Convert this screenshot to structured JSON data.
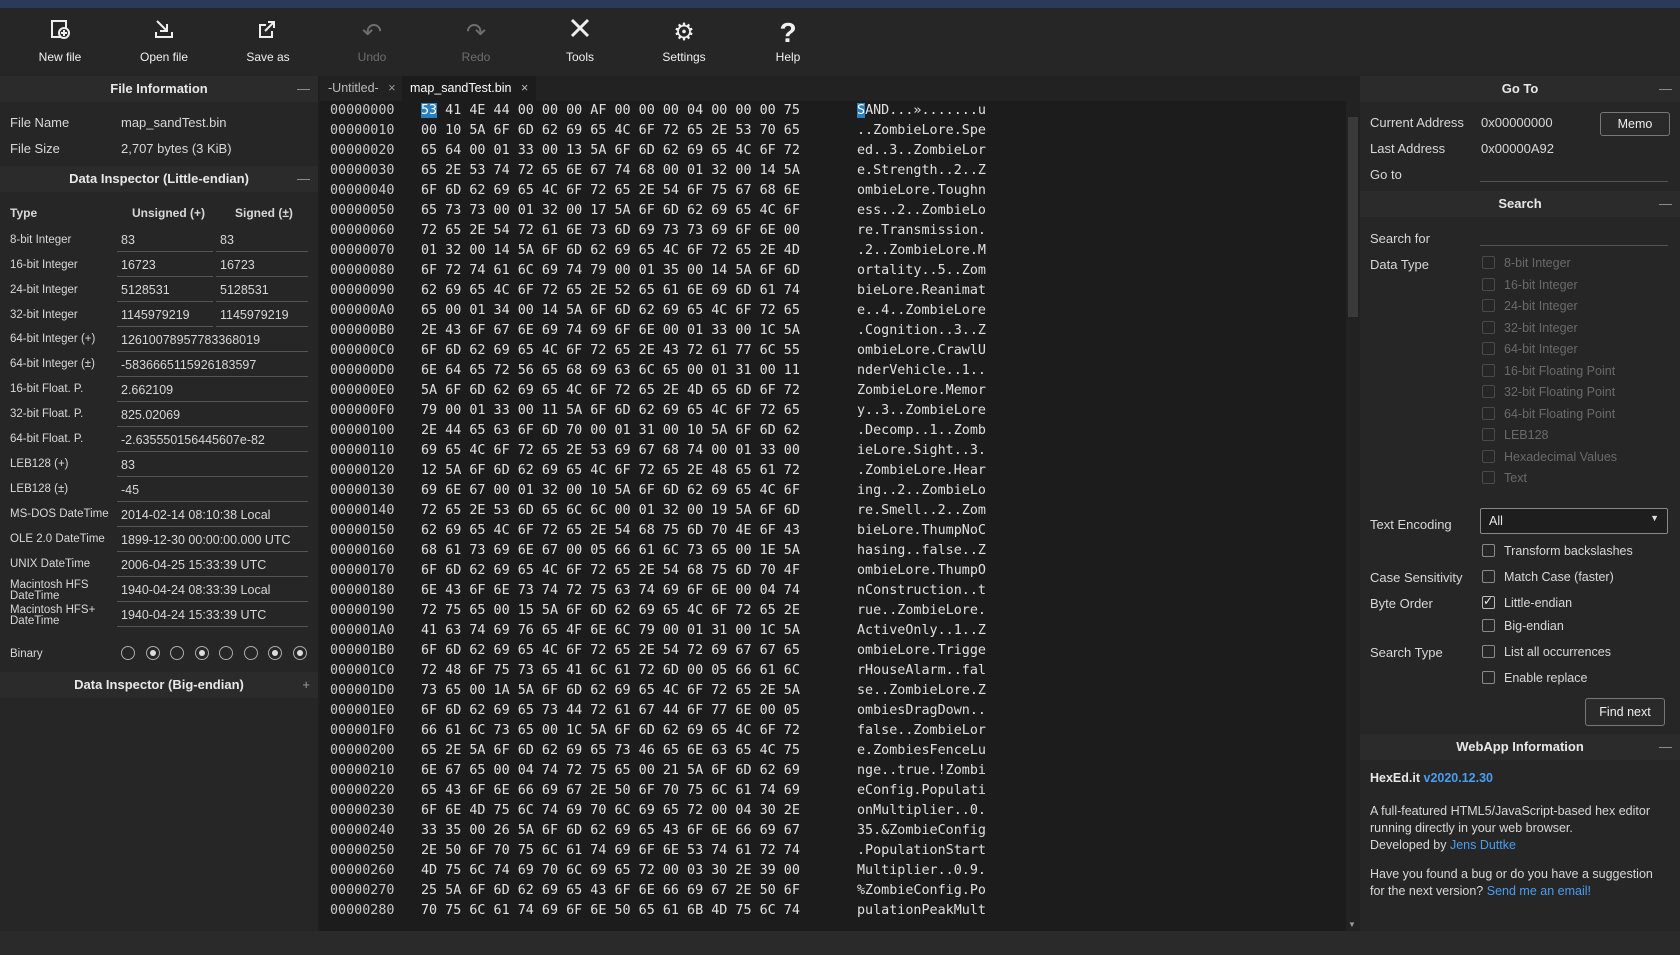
{
  "toolbar": {
    "new_file": "New file",
    "open_file": "Open file",
    "save_as": "Save as",
    "undo": "Undo",
    "redo": "Redo",
    "tools": "Tools",
    "settings": "Settings",
    "help": "Help"
  },
  "file_info": {
    "title": "File Information",
    "name_label": "File Name",
    "name_value": "map_sandTest.bin",
    "size_label": "File Size",
    "size_value": "2,707 bytes (3 KiB)"
  },
  "inspector_le": {
    "title": "Data Inspector (Little-endian)",
    "col_type": "Type",
    "col_unsigned": "Unsigned (+)",
    "col_signed": "Signed (±)",
    "rows": [
      {
        "type": "8-bit Integer",
        "unsigned": "83",
        "signed": "83"
      },
      {
        "type": "16-bit Integer",
        "unsigned": "16723",
        "signed": "16723"
      },
      {
        "type": "24-bit Integer",
        "unsigned": "5128531",
        "signed": "5128531"
      },
      {
        "type": "32-bit Integer",
        "unsigned": "1145979219",
        "signed": "1145979219"
      }
    ],
    "wide_rows": [
      {
        "type": "64-bit Integer (+)",
        "value": "12610078957783368019"
      },
      {
        "type": "64-bit Integer (±)",
        "value": "-5836665115926183597"
      },
      {
        "type": "16-bit Float. P.",
        "value": "2.662109"
      },
      {
        "type": "32-bit Float. P.",
        "value": "825.02069"
      },
      {
        "type": "64-bit Float. P.",
        "value": "-2.635550156445607e-82"
      },
      {
        "type": "LEB128 (+)",
        "value": "83"
      },
      {
        "type": "LEB128 (±)",
        "value": "-45"
      },
      {
        "type": "MS-DOS DateTime",
        "value": "2014-02-14 08:10:38 Local"
      },
      {
        "type": "OLE 2.0 DateTime",
        "value": "1899-12-30 00:00:00.000 UTC"
      },
      {
        "type": "UNIX DateTime",
        "value": "2006-04-25 15:33:39 UTC"
      },
      {
        "type": "Macintosh HFS DateTime",
        "value": "1940-04-24 08:33:39 Local"
      },
      {
        "type": "Macintosh HFS+ DateTime",
        "value": "1940-04-24 15:33:39 UTC"
      }
    ],
    "binary_label": "Binary",
    "binary_bits": [
      0,
      1,
      0,
      1,
      0,
      0,
      1,
      1
    ]
  },
  "inspector_be": {
    "title": "Data Inspector (Big-endian)"
  },
  "tabs": [
    {
      "label": "-Untitled-"
    },
    {
      "label": "map_sandTest.bin"
    }
  ],
  "hex_rows": [
    {
      "off": "00000000",
      "bytes": "53 41 4E 44 00 00 00 AF 00 00 00 04 00 00 00 75",
      "ascii": "SAND...».......u"
    },
    {
      "off": "00000010",
      "bytes": "00 10 5A 6F 6D 62 69 65 4C 6F 72 65 2E 53 70 65",
      "ascii": "..ZombieLore.Spe"
    },
    {
      "off": "00000020",
      "bytes": "65 64 00 01 33 00 13 5A 6F 6D 62 69 65 4C 6F 72",
      "ascii": "ed..3..ZombieLor"
    },
    {
      "off": "00000030",
      "bytes": "65 2E 53 74 72 65 6E 67 74 68 00 01 32 00 14 5A",
      "ascii": "e.Strength..2..Z"
    },
    {
      "off": "00000040",
      "bytes": "6F 6D 62 69 65 4C 6F 72 65 2E 54 6F 75 67 68 6E",
      "ascii": "ombieLore.Toughn"
    },
    {
      "off": "00000050",
      "bytes": "65 73 73 00 01 32 00 17 5A 6F 6D 62 69 65 4C 6F",
      "ascii": "ess..2..ZombieLo"
    },
    {
      "off": "00000060",
      "bytes": "72 65 2E 54 72 61 6E 73 6D 69 73 73 69 6F 6E 00",
      "ascii": "re.Transmission."
    },
    {
      "off": "00000070",
      "bytes": "01 32 00 14 5A 6F 6D 62 69 65 4C 6F 72 65 2E 4D",
      "ascii": ".2..ZombieLore.M"
    },
    {
      "off": "00000080",
      "bytes": "6F 72 74 61 6C 69 74 79 00 01 35 00 14 5A 6F 6D",
      "ascii": "ortality..5..Zom"
    },
    {
      "off": "00000090",
      "bytes": "62 69 65 4C 6F 72 65 2E 52 65 61 6E 69 6D 61 74",
      "ascii": "bieLore.Reanimat"
    },
    {
      "off": "000000A0",
      "bytes": "65 00 01 34 00 14 5A 6F 6D 62 69 65 4C 6F 72 65",
      "ascii": "e..4..ZombieLore"
    },
    {
      "off": "000000B0",
      "bytes": "2E 43 6F 67 6E 69 74 69 6F 6E 00 01 33 00 1C 5A",
      "ascii": ".Cognition..3..Z"
    },
    {
      "off": "000000C0",
      "bytes": "6F 6D 62 69 65 4C 6F 72 65 2E 43 72 61 77 6C 55",
      "ascii": "ombieLore.CrawlU"
    },
    {
      "off": "000000D0",
      "bytes": "6E 64 65 72 56 65 68 69 63 6C 65 00 01 31 00 11",
      "ascii": "nderVehicle..1.."
    },
    {
      "off": "000000E0",
      "bytes": "5A 6F 6D 62 69 65 4C 6F 72 65 2E 4D 65 6D 6F 72",
      "ascii": "ZombieLore.Memor"
    },
    {
      "off": "000000F0",
      "bytes": "79 00 01 33 00 11 5A 6F 6D 62 69 65 4C 6F 72 65",
      "ascii": "y..3..ZombieLore"
    },
    {
      "off": "00000100",
      "bytes": "2E 44 65 63 6F 6D 70 00 01 31 00 10 5A 6F 6D 62",
      "ascii": ".Decomp..1..Zomb"
    },
    {
      "off": "00000110",
      "bytes": "69 65 4C 6F 72 65 2E 53 69 67 68 74 00 01 33 00",
      "ascii": "ieLore.Sight..3."
    },
    {
      "off": "00000120",
      "bytes": "12 5A 6F 6D 62 69 65 4C 6F 72 65 2E 48 65 61 72",
      "ascii": ".ZombieLore.Hear"
    },
    {
      "off": "00000130",
      "bytes": "69 6E 67 00 01 32 00 10 5A 6F 6D 62 69 65 4C 6F",
      "ascii": "ing..2..ZombieLo"
    },
    {
      "off": "00000140",
      "bytes": "72 65 2E 53 6D 65 6C 6C 00 01 32 00 19 5A 6F 6D",
      "ascii": "re.Smell..2..Zom"
    },
    {
      "off": "00000150",
      "bytes": "62 69 65 4C 6F 72 65 2E 54 68 75 6D 70 4E 6F 43",
      "ascii": "bieLore.ThumpNoC"
    },
    {
      "off": "00000160",
      "bytes": "68 61 73 69 6E 67 00 05 66 61 6C 73 65 00 1E 5A",
      "ascii": "hasing..false..Z"
    },
    {
      "off": "00000170",
      "bytes": "6F 6D 62 69 65 4C 6F 72 65 2E 54 68 75 6D 70 4F",
      "ascii": "ombieLore.ThumpO"
    },
    {
      "off": "00000180",
      "bytes": "6E 43 6F 6E 73 74 72 75 63 74 69 6F 6E 00 04 74",
      "ascii": "nConstruction..t"
    },
    {
      "off": "00000190",
      "bytes": "72 75 65 00 15 5A 6F 6D 62 69 65 4C 6F 72 65 2E",
      "ascii": "rue..ZombieLore."
    },
    {
      "off": "000001A0",
      "bytes": "41 63 74 69 76 65 4F 6E 6C 79 00 01 31 00 1C 5A",
      "ascii": "ActiveOnly..1..Z"
    },
    {
      "off": "000001B0",
      "bytes": "6F 6D 62 69 65 4C 6F 72 65 2E 54 72 69 67 67 65",
      "ascii": "ombieLore.Trigge"
    },
    {
      "off": "000001C0",
      "bytes": "72 48 6F 75 73 65 41 6C 61 72 6D 00 05 66 61 6C",
      "ascii": "rHouseAlarm..fal"
    },
    {
      "off": "000001D0",
      "bytes": "73 65 00 1A 5A 6F 6D 62 69 65 4C 6F 72 65 2E 5A",
      "ascii": "se..ZombieLore.Z"
    },
    {
      "off": "000001E0",
      "bytes": "6F 6D 62 69 65 73 44 72 61 67 44 6F 77 6E 00 05",
      "ascii": "ombiesDragDown.."
    },
    {
      "off": "000001F0",
      "bytes": "66 61 6C 73 65 00 1C 5A 6F 6D 62 69 65 4C 6F 72",
      "ascii": "false..ZombieLor"
    },
    {
      "off": "00000200",
      "bytes": "65 2E 5A 6F 6D 62 69 65 73 46 65 6E 63 65 4C 75",
      "ascii": "e.ZombiesFenceLu"
    },
    {
      "off": "00000210",
      "bytes": "6E 67 65 00 04 74 72 75 65 00 21 5A 6F 6D 62 69",
      "ascii": "nge..true.!Zombi"
    },
    {
      "off": "00000220",
      "bytes": "65 43 6F 6E 66 69 67 2E 50 6F 70 75 6C 61 74 69",
      "ascii": "eConfig.Populati"
    },
    {
      "off": "00000230",
      "bytes": "6F 6E 4D 75 6C 74 69 70 6C 69 65 72 00 04 30 2E",
      "ascii": "onMultiplier..0."
    },
    {
      "off": "00000240",
      "bytes": "33 35 00 26 5A 6F 6D 62 69 65 43 6F 6E 66 69 67",
      "ascii": "35.&ZombieConfig"
    },
    {
      "off": "00000250",
      "bytes": "2E 50 6F 70 75 6C 61 74 69 6F 6E 53 74 61 72 74",
      "ascii": ".PopulationStart"
    },
    {
      "off": "00000260",
      "bytes": "4D 75 6C 74 69 70 6C 69 65 72 00 03 30 2E 39 00",
      "ascii": "Multiplier..0.9."
    },
    {
      "off": "00000270",
      "bytes": "25 5A 6F 6D 62 69 65 43 6F 6E 66 69 67 2E 50 6F",
      "ascii": "%ZombieConfig.Po"
    },
    {
      "off": "00000280",
      "bytes": "70 75 6C 61 74 69 6F 6E 50 65 61 6B 4D 75 6C 74",
      "ascii": "pulationPeakMult"
    }
  ],
  "goto": {
    "title": "Go To",
    "current_label": "Current Address",
    "current_value": "0x00000000",
    "memo_label": "Memo",
    "last_label": "Last Address",
    "last_value": "0x00000A92",
    "goto_label": "Go to"
  },
  "search": {
    "title": "Search",
    "search_for_label": "Search for",
    "data_type_label": "Data Type",
    "data_types": [
      "8-bit Integer",
      "16-bit Integer",
      "24-bit Integer",
      "32-bit Integer",
      "64-bit Integer",
      "16-bit Floating Point",
      "32-bit Floating Point",
      "64-bit Floating Point",
      "LEB128",
      "Hexadecimal Values",
      "Text"
    ],
    "encoding_label": "Text Encoding",
    "encoding_value": "All",
    "transform_label": "Transform backslashes",
    "case_label": "Case Sensitivity",
    "match_case_label": "Match Case (faster)",
    "byte_order_label": "Byte Order",
    "little_endian_label": "Little-endian",
    "big_endian_label": "Big-endian",
    "search_type_label": "Search Type",
    "list_all_label": "List all occurrences",
    "enable_replace_label": "Enable replace",
    "find_next_label": "Find next"
  },
  "webapp": {
    "title": "WebApp Information",
    "name": "HexEd.it",
    "version": "v2020.12.30",
    "desc": "A full-featured HTML5/JavaScript-based hex editor running directly in your web browser.",
    "dev_prefix": "Developed by",
    "dev_name": "Jens Duttke",
    "bug_text": "Have you found a bug or do you have a suggestion for the next version?",
    "email_link": "Send me an email!"
  },
  "colors": {
    "accent": "#2a7fbf",
    "link": "#4a9df0"
  }
}
